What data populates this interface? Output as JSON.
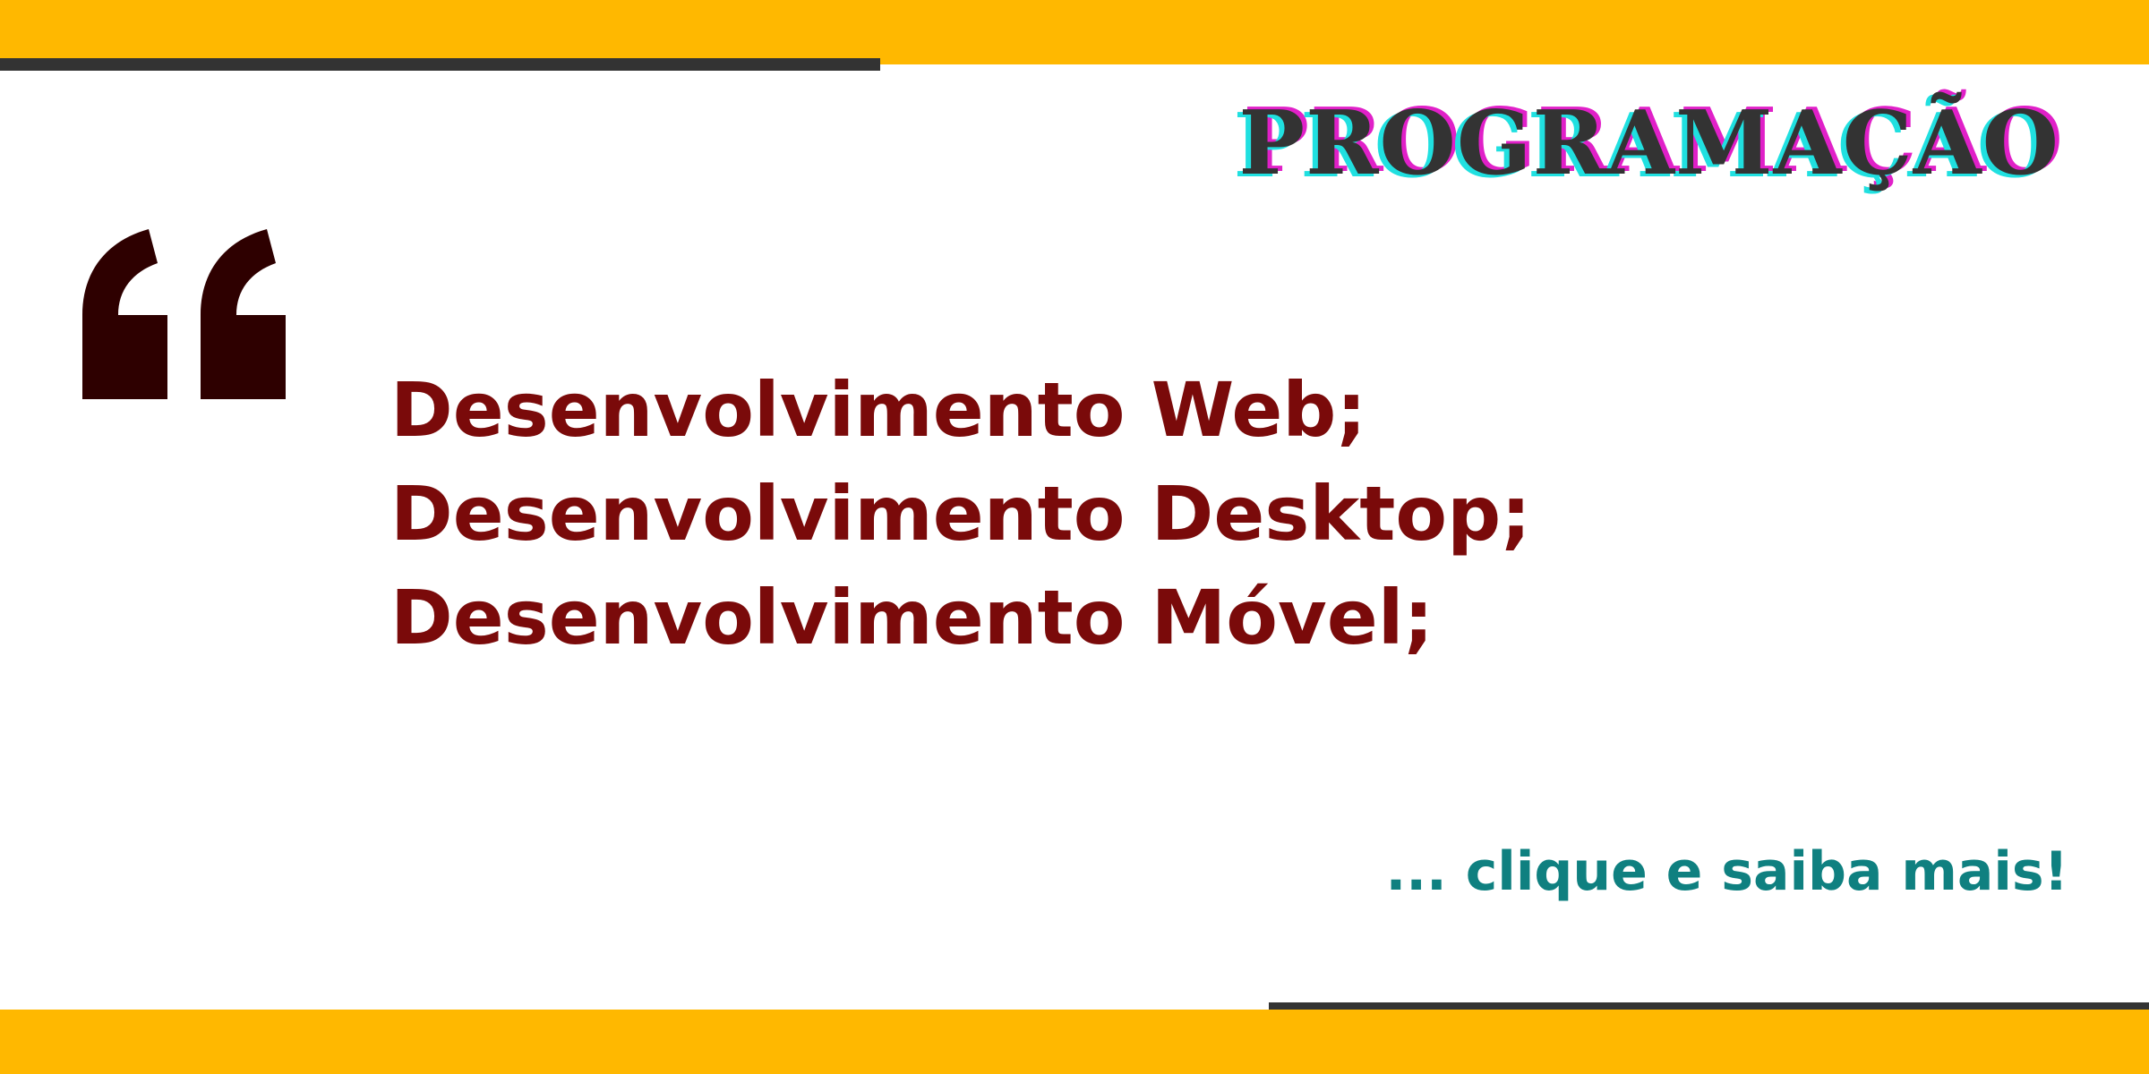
{
  "banner": {
    "title": "PROGRAMAÇÃO",
    "items": [
      "Desenvolvimento Web;",
      "Desenvolvimento Desktop;",
      "Desenvolvimento Móvel;"
    ],
    "cta_text": "... clique e saiba mais!",
    "quote_icon": "left-double-quote-icon"
  },
  "colors": {
    "accent_bar": "#FFB800",
    "stripe": "#333333",
    "title_fill": "#333333",
    "title_glow_cyan": "#20E0E0",
    "title_glow_magenta": "#E020C8",
    "item_text": "#7A0A0A",
    "quote_icon": "#2E0000",
    "cta_text": "#0F8080"
  }
}
